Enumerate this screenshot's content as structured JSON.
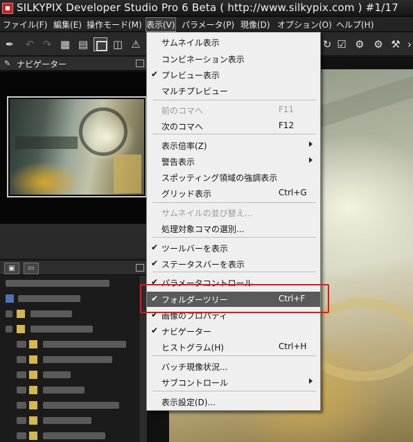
{
  "title": {
    "text": "SILKYPIX Developer Studio Pro 6 Beta ( http://www.silkypix.com )   #1/17"
  },
  "menubar": [
    {
      "label": "ファイル(F)"
    },
    {
      "label": "編集(E)"
    },
    {
      "label": "操作モード(M)"
    },
    {
      "label": "表示(V)"
    },
    {
      "label": "パラメータ(P)"
    },
    {
      "label": "現像(D)"
    },
    {
      "label": "オプション(O)"
    },
    {
      "label": "ヘルプ(H)"
    }
  ],
  "navigator": {
    "title": "ナビゲーター"
  },
  "tree": {
    "tab1_icon": "folder-tree-icon",
    "tab2_icon": "comment-icon"
  },
  "view_menu": {
    "items": [
      {
        "label": "サムネイル表示",
        "checked": false,
        "shortcut": "",
        "disabled": false,
        "submenu": false
      },
      {
        "label": "コンビネーション表示",
        "checked": false,
        "shortcut": "",
        "disabled": false,
        "submenu": false
      },
      {
        "label": "プレビュー表示",
        "checked": true,
        "shortcut": "",
        "disabled": false,
        "submenu": false
      },
      {
        "label": "マルチプレビュー",
        "checked": false,
        "shortcut": "",
        "disabled": false,
        "submenu": false
      },
      {
        "label": "前のコマへ",
        "checked": false,
        "shortcut": "F11",
        "disabled": true,
        "submenu": false
      },
      {
        "label": "次のコマへ",
        "checked": false,
        "shortcut": "F12",
        "disabled": false,
        "submenu": false
      },
      {
        "label": "表示倍率(Z)",
        "checked": false,
        "shortcut": "",
        "disabled": false,
        "submenu": true
      },
      {
        "label": "警告表示",
        "checked": false,
        "shortcut": "",
        "disabled": false,
        "submenu": true
      },
      {
        "label": "スポッティング領域の強調表示",
        "checked": false,
        "shortcut": "",
        "disabled": false,
        "submenu": false
      },
      {
        "label": "グリッド表示",
        "checked": false,
        "shortcut": "Ctrl+G",
        "disabled": false,
        "submenu": false
      },
      {
        "label": "サムネイルの並び替え...",
        "checked": false,
        "shortcut": "",
        "disabled": true,
        "submenu": false
      },
      {
        "label": "処理対象コマの選別...",
        "checked": false,
        "shortcut": "",
        "disabled": false,
        "submenu": false
      },
      {
        "label": "ツールバーを表示",
        "checked": true,
        "shortcut": "",
        "disabled": false,
        "submenu": false
      },
      {
        "label": "ステータスバーを表示",
        "checked": true,
        "shortcut": "",
        "disabled": false,
        "submenu": false
      },
      {
        "label": "パラメータコントロール",
        "checked": true,
        "shortcut": "",
        "disabled": false,
        "submenu": false
      },
      {
        "label": "フォルダーツリー",
        "checked": true,
        "shortcut": "Ctrl+F",
        "disabled": false,
        "submenu": false,
        "highlighted": true
      },
      {
        "label": "画像のプロパティ",
        "checked": true,
        "shortcut": "",
        "disabled": false,
        "submenu": false
      },
      {
        "label": "ナビゲーター",
        "checked": true,
        "shortcut": "",
        "disabled": false,
        "submenu": false
      },
      {
        "label": "ヒストグラム(H)",
        "checked": false,
        "shortcut": "Ctrl+H",
        "disabled": false,
        "submenu": false
      },
      {
        "label": "バッチ現像状況...",
        "checked": false,
        "shortcut": "",
        "disabled": false,
        "submenu": false
      },
      {
        "label": "サブコントロール",
        "checked": false,
        "shortcut": "",
        "disabled": false,
        "submenu": true
      },
      {
        "label": "表示設定(D)...",
        "checked": false,
        "shortcut": "",
        "disabled": false,
        "submenu": false
      }
    ]
  },
  "glyphs": {
    "check": "✔"
  },
  "colors": {
    "annotation": "#e8141c",
    "menu_highlight": "#5a5a5a"
  }
}
